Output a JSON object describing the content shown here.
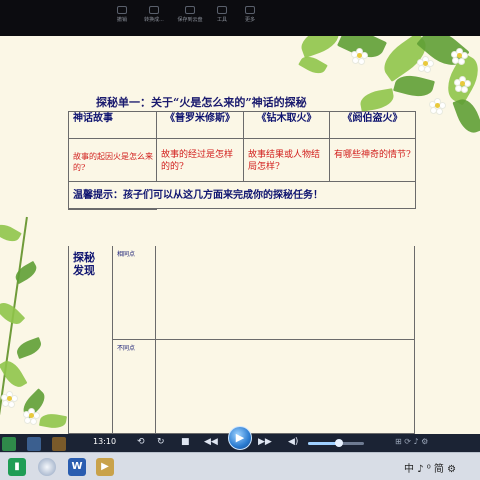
{
  "toolbar": {
    "items": [
      {
        "label": "撤销"
      },
      {
        "label": "转换成..."
      },
      {
        "label": "保存到云盘"
      },
      {
        "label": "工具"
      },
      {
        "label": "更多"
      }
    ]
  },
  "slide": {
    "title": "探秘单一：关于“火是怎么来的”神话的探秘",
    "table": {
      "header": [
        "神话故事",
        "《普罗米修斯》",
        "《钻木取火》",
        "《阏伯盗火》"
      ],
      "questions": [
        "故事的起因火是怎么来的?",
        "故事的经过是怎样的的?",
        "故事结果或人物结局怎样?",
        "有哪些神奇的情节?"
      ],
      "tip": "温馨提示：孩子们可以从这几方面来完成你的探秘任务！",
      "explore_label": "探秘发现",
      "same_label": "相同点",
      "diff_label": "不同点"
    }
  },
  "player": {
    "time": "13:10",
    "volume_level": 0.55
  },
  "taskbar": {
    "tray_text": "中 ♪ ⁰ 简 ⚙"
  },
  "colors": {
    "title": "#1a1a6e",
    "question_red": "#d2201e",
    "slide_bg": "#fbf7e6",
    "player_bg": "#1b2334"
  }
}
